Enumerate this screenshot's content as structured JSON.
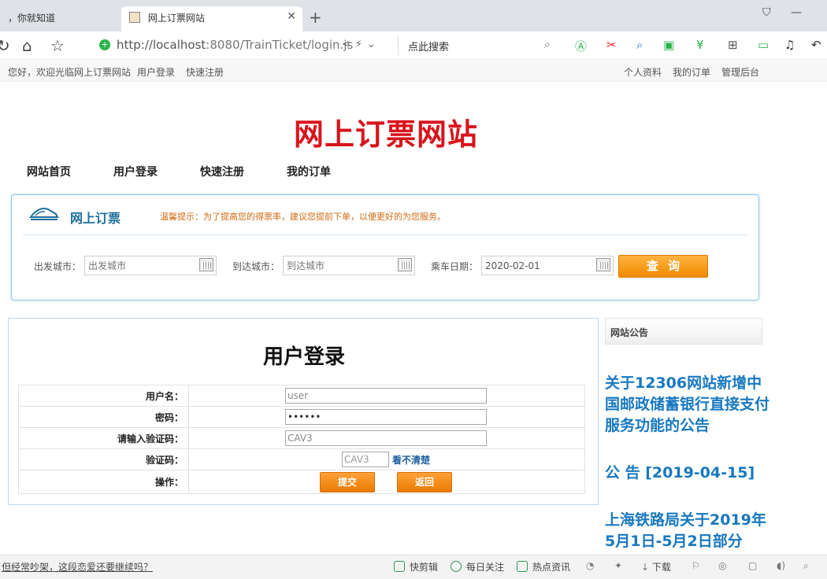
{
  "browser": {
    "tabs": [
      {
        "label": "，你就知道"
      },
      {
        "label": "网上订票网站"
      }
    ],
    "url_host": "http://localhost",
    "url_rest": ":8080/TrainTicket/login.js",
    "search_placeholder": "点此搜索"
  },
  "sitebar": {
    "welcome": "您好，欢迎光临网上订票网站",
    "login": "用户登录",
    "register": "快速注册",
    "profile": "个人资料",
    "orders": "我的订单",
    "admin": "管理后台"
  },
  "site_title": "网上订票网站",
  "main_nav": [
    "网站首页",
    "用户登录",
    "快速注册",
    "我的订单"
  ],
  "ticket_panel": {
    "title": "网上订票",
    "tip": "温馨提示：为了提高您的得票率，建议您提前下单，以便更好的为您服务。",
    "from_label": "出发城市：",
    "from_placeholder": "出发城市",
    "to_label": "到达城市：",
    "to_placeholder": "到达城市",
    "date_label": "乘车日期：",
    "date_value": "2020-02-01",
    "query_button": "查询"
  },
  "login": {
    "title": "用户登录",
    "username_label": "用户名：",
    "username_value": "user",
    "password_label": "密码：",
    "password_value": "••••••",
    "captcha_input_label": "请输入验证码：",
    "captcha_input_value": "CAV3",
    "captcha_label": "验证码：",
    "captcha_image": "CAV3",
    "captcha_refresh": "看不清楚",
    "action_label": "操作：",
    "submit": "提交",
    "back": "返回"
  },
  "notice": {
    "heading": "网站公告",
    "items": [
      "关于12306网站新增中国邮政储蓄银行直接支付服务功能的公告",
      "公 告 [2019-04-15]",
      "上海铁路局关于2019年5月1日-5月2日部分"
    ]
  },
  "statusbar": {
    "left_text": "但经常吵架，这段恋爱还要继续吗？",
    "items": [
      "快剪辑",
      "每日关注",
      "热点资讯",
      "下载"
    ]
  },
  "colors": {
    "title_red": "#d8141c",
    "accent_blue": "#1c6e9c",
    "button_orange": "#f08a00"
  }
}
